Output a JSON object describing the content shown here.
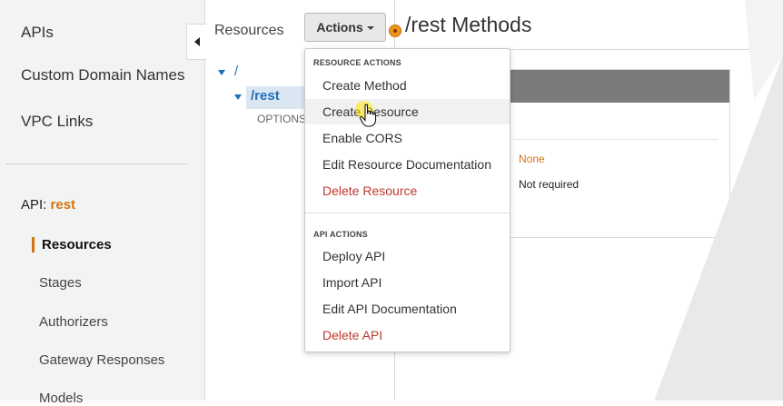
{
  "leftnav": {
    "top_items": [
      "APIs",
      "Custom Domain Names",
      "VPC Links"
    ],
    "api_prefix": "API:",
    "api_name": "rest",
    "sub_items": [
      "Resources",
      "Stages",
      "Authorizers",
      "Gateway Responses",
      "Models"
    ],
    "active_item": "Resources"
  },
  "resources": {
    "heading": "Resources",
    "tree": {
      "root": "/",
      "child": "/rest",
      "method": "OPTIONS"
    }
  },
  "actions_button": {
    "label": "Actions"
  },
  "main": {
    "title": "/rest Methods",
    "detail_values": [
      "None",
      "Not required"
    ]
  },
  "dropdown": {
    "resource_section": "RESOURCE ACTIONS",
    "resource_items": [
      {
        "label": "Create Method",
        "danger": false
      },
      {
        "label": "Create Resource",
        "danger": false,
        "hovered": true
      },
      {
        "label": "Enable CORS",
        "danger": false
      },
      {
        "label": "Edit Resource Documentation",
        "danger": false
      },
      {
        "label": "Delete Resource",
        "danger": true
      }
    ],
    "api_section": "API ACTIONS",
    "api_items": [
      {
        "label": "Deploy API",
        "danger": false
      },
      {
        "label": "Import API",
        "danger": false
      },
      {
        "label": "Edit API Documentation",
        "danger": false
      },
      {
        "label": "Delete API",
        "danger": true
      }
    ]
  },
  "colors": {
    "accent_orange": "#d6730f",
    "link_blue": "#1f6fb8",
    "danger_red": "#c0392b",
    "nav_bg": "#f2f3f3"
  }
}
